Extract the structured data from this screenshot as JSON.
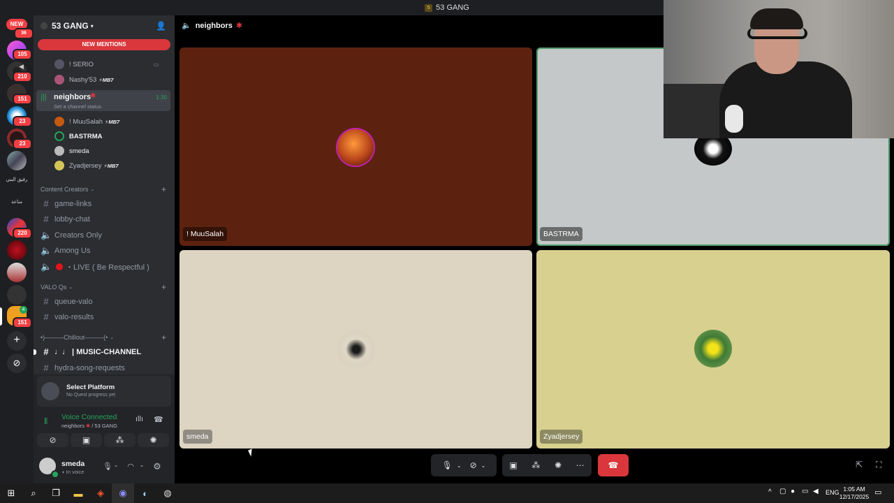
{
  "window": {
    "title": "53 GANG"
  },
  "guilds": {
    "new_label": "NEW",
    "badges": [
      "36",
      "105",
      "210",
      "151",
      "23",
      "23",
      "220",
      "151",
      "4"
    ],
    "add_server_icon": "plus-icon",
    "discover_icon": "compass-icon",
    "server_text_1": "رفيق البني",
    "server_text_2": "مناعة"
  },
  "server": {
    "name": "53 GANG",
    "new_mentions": "NEW MENTIONS"
  },
  "sidebar": {
    "voice_users_top": [
      {
        "name": "! SERIO"
      },
      {
        "name": "Nashy'53",
        "tag": "MB7"
      }
    ],
    "active_channel": {
      "name": "neighbors",
      "time": "1:30",
      "status": "Set a channel status"
    },
    "voice_users": [
      {
        "name": "! MuuSalah",
        "tag": "MB7"
      },
      {
        "name": "BASTRMA"
      },
      {
        "name": "smeda"
      },
      {
        "name": "Zyadjersey",
        "tag": "MB7"
      }
    ],
    "cat1": "Content Creators",
    "channels1": [
      {
        "name": "game-links",
        "type": "text"
      },
      {
        "name": "lobby-chat",
        "type": "text"
      },
      {
        "name": "Creators Only",
        "type": "voice"
      },
      {
        "name": "Among Us",
        "type": "voice"
      },
      {
        "name": "・LIVE ( Be Respectful )",
        "type": "voice"
      }
    ],
    "cat2": "VALO Qs",
    "channels2": [
      {
        "name": "queue-valo",
        "type": "text"
      },
      {
        "name": "valo-results",
        "type": "text"
      }
    ],
    "cat3": "•)———Chillout———(•",
    "channels3": [
      {
        "name": "♩♩ | MUSIC-CHANNEL",
        "type": "text"
      },
      {
        "name": "hydra-song-requests",
        "type": "text"
      }
    ]
  },
  "quest": {
    "title": "Select Platform",
    "sub": "No Quest progress yet"
  },
  "voice": {
    "status": "Voice Connected",
    "channel": "neighbors",
    "server": "/ 53 GANG"
  },
  "user": {
    "name": "smeda",
    "status": "In voice"
  },
  "header": {
    "channel": "neighbors"
  },
  "tiles": [
    {
      "name": "! MuuSalah",
      "bg": "#5d220f"
    },
    {
      "name": "BASTRMA",
      "bg": "#c4c8c8"
    },
    {
      "name": "smeda",
      "bg": "#ddd5c2"
    },
    {
      "name": "Zyadjersey",
      "bg": "#d8d08f"
    }
  ],
  "taskbar": {
    "lang": "ENG",
    "time": "1:05 AM",
    "date": "12/17/2025"
  },
  "colors": {
    "accent": "#23a55a",
    "danger": "#da373c",
    "brand": "#5865f2"
  }
}
